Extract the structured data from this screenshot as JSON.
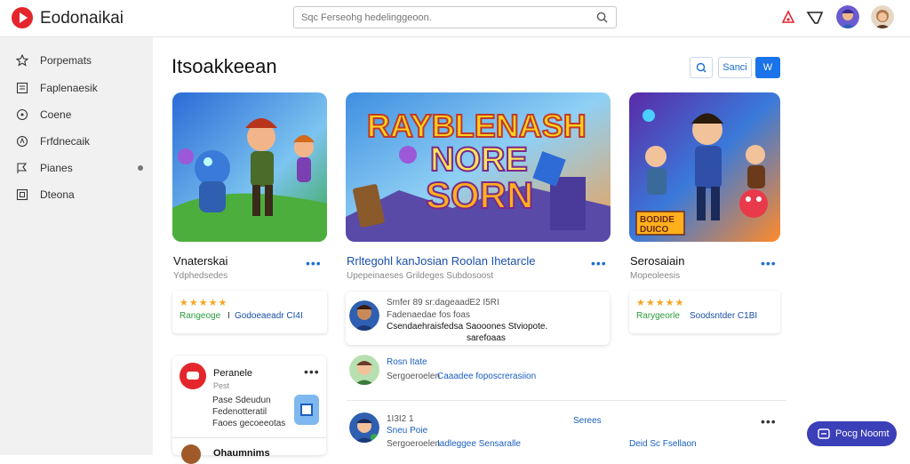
{
  "app": {
    "title": "Eodonaikai",
    "search_placeholder": "Sqc Ferseohg hedelinggeoon."
  },
  "sidebar": {
    "items": [
      {
        "label": "Porpemats"
      },
      {
        "label": "Faplenaesik"
      },
      {
        "label": "Coene"
      },
      {
        "label": "Frfdnecaik"
      },
      {
        "label": "Pianes"
      },
      {
        "label": "Dteona"
      }
    ]
  },
  "main": {
    "title": "Itsoakkeean",
    "buttons": {
      "secondary": "Sanci",
      "primary": "W"
    },
    "games": [
      {
        "title": "Vnaterskai",
        "subtitle": "Ydphedsedes",
        "stats": {
          "rating": "★★★★★",
          "label_green": "Rangeoge",
          "separator": "I",
          "label_blue": "Godoeaeadr CI4I"
        }
      },
      {
        "title": "Rrltegohl kanJosian Roolan Ihetarcle",
        "subtitle": "Upepeinaeses Grildeges Subdosoost",
        "banner_text": "RAYBLENASH NORE SORN"
      },
      {
        "title": "Serosaiain",
        "subtitle": "Mopeoleesis",
        "stats": {
          "rating": "★★★★★",
          "label_green": "Rarygeorle",
          "label_blue": "Soodsntder C1BI"
        },
        "badge_text": "BODIDE DUICO"
      }
    ],
    "comment": {
      "line1": "Smfer 89 sr:dageaadE2 I5RI",
      "line2": "Fadenaedae fos foas",
      "line3": "Csendaehraisfedsa Saooones Stviopote.",
      "line4": "sarefoaas"
    },
    "feed_left": {
      "title": "Peranele",
      "subtitle": "Pest",
      "lines": [
        "Pase Sdeudun",
        "Fedenotteratil",
        "Faoes gecoeeotas"
      ],
      "next_title": "Ohaumnims"
    },
    "feed_right": [
      {
        "name": "Rosn Itate",
        "text_gray": "Sergoeroelen",
        "text_blue": "Caaadee foposcrerasiion"
      },
      {
        "meta": "1I3I2 1",
        "name": "Sneu Poie",
        "text_gray": "Sergoeroelen",
        "text_blue": "Iadleggee Sensaralle",
        "tag": "Serees"
      }
    ],
    "far_right": {
      "date": "Deid Sc Fsellaon"
    }
  },
  "fab": {
    "label": "Pocg Noomt"
  },
  "colors": {
    "accent": "#1a6fd1",
    "brand": "#e4262c",
    "fab": "#3b3fb8"
  }
}
